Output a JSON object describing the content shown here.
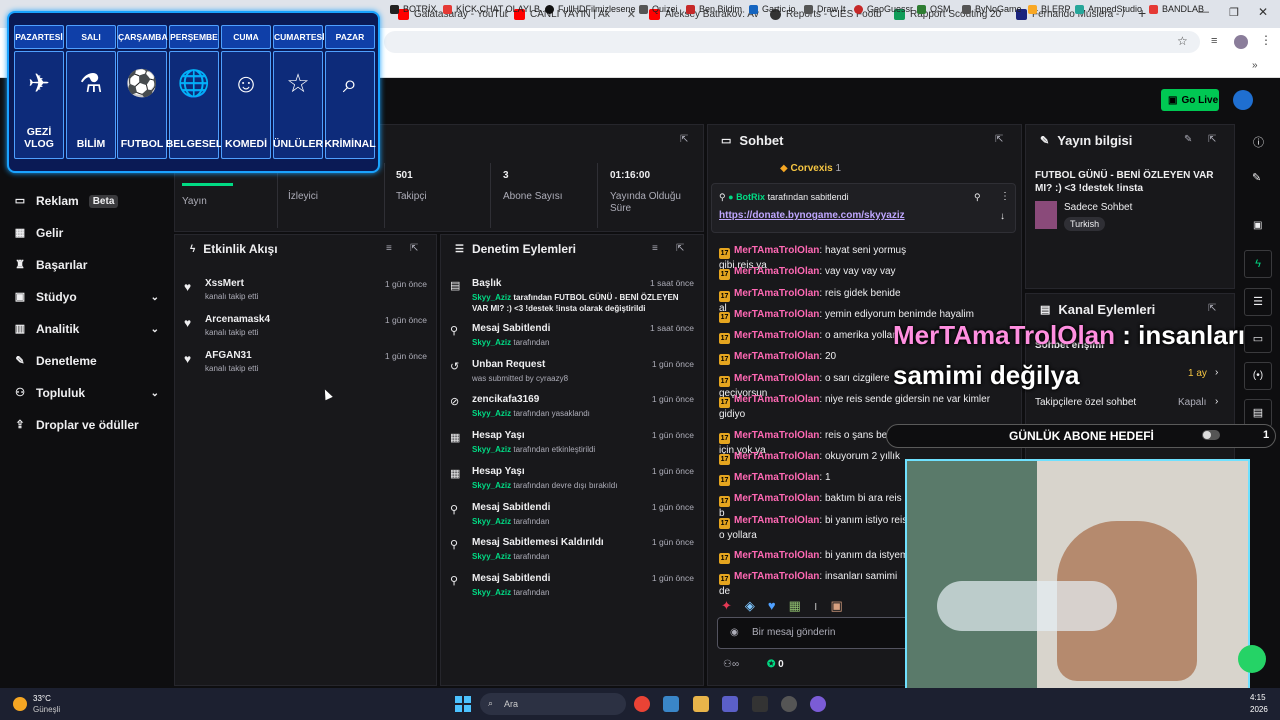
{
  "browser": {
    "tabs": [
      {
        "title": "Galatasaray - YouTube",
        "color": "#ff0000"
      },
      {
        "title": "CANLI YAYIN | Ak",
        "color": "#ff0000"
      },
      {
        "title": "Aleksey Batrakov: Av",
        "color": "#ff0000"
      },
      {
        "title": "Reports - CIES Footb",
        "color": "#333333"
      },
      {
        "title": "Rapport Scouting 20",
        "color": "#0f9d58"
      },
      {
        "title": "Fernando Muslera - /",
        "color": "#1a237e"
      }
    ],
    "new_tab": "+",
    "bookmarks": [
      "BOTRİX",
      "KİCK CHAT OLAYI B...",
      "FullHDFilmizlesene",
      "Quizei",
      "Ben Bildim",
      "Gartic.io",
      "Draw It",
      "GeoGuessr",
      "OSM",
      "ByNoGame",
      "BLERP",
      "AmpedStudio",
      "BANDLAB"
    ]
  },
  "header": {
    "go_live": "Go Live"
  },
  "schedule": {
    "days": [
      {
        "day": "PAZARTESİ",
        "category": "GEZİ VLOG",
        "icon": "globe-plane-icon",
        "glyph": "✈"
      },
      {
        "day": "SALI",
        "category": "BİLİM",
        "icon": "science-icon",
        "glyph": "⚗"
      },
      {
        "day": "ÇARŞAMBA",
        "category": "FUTBOL",
        "icon": "football-icon",
        "glyph": "⚽"
      },
      {
        "day": "PERŞEMBE",
        "category": "BELGESEL",
        "icon": "globe-icon",
        "glyph": "🌐"
      },
      {
        "day": "CUMA",
        "category": "KOMEDİ",
        "icon": "theater-mask-icon",
        "glyph": "☺"
      },
      {
        "day": "CUMARTESİ",
        "category": "ÜNLÜLER",
        "icon": "star-icon",
        "glyph": "☆"
      },
      {
        "day": "PAZAR",
        "category": "KRİMİNAL",
        "icon": "fingerprint-magnifier-icon",
        "glyph": "⌕"
      }
    ]
  },
  "sidebar": {
    "items": [
      {
        "label": "Reklam",
        "badge": "Beta",
        "icon": "ad-icon",
        "glyph": "▭"
      },
      {
        "label": "Gelir",
        "icon": "revenue-icon",
        "glyph": "▦"
      },
      {
        "label": "Başarılar",
        "icon": "trophy-icon",
        "glyph": "♜"
      },
      {
        "label": "Stüdyo",
        "icon": "studio-icon",
        "glyph": "▣",
        "chevron": "⌄"
      },
      {
        "label": "Analitik",
        "icon": "analytics-icon",
        "glyph": "▥",
        "chevron": "⌄"
      },
      {
        "label": "Denetleme",
        "icon": "wrench-icon",
        "glyph": "✎"
      },
      {
        "label": "Topluluk",
        "icon": "community-icon",
        "glyph": "⚇",
        "chevron": "⌄"
      },
      {
        "label": "Droplar ve ödüller",
        "icon": "drops-icon",
        "glyph": "⇪"
      }
    ]
  },
  "stats": {
    "items": [
      {
        "value": "",
        "label": "Yayın"
      },
      {
        "value": "",
        "label": "İzleyici"
      },
      {
        "value": "501",
        "label": "Takipçi"
      },
      {
        "value": "3",
        "label": "Abone Sayısı"
      },
      {
        "value": "01:16:00",
        "label": "Yayında Olduğu Süre"
      }
    ]
  },
  "activity": {
    "title": "Etkinlik Akışı",
    "items": [
      {
        "user": "XssMert",
        "action": "kanalı takip etti",
        "time": "1 gün önce"
      },
      {
        "user": "Arcenamask4",
        "action": "kanalı takip etti",
        "time": "1 gün önce"
      },
      {
        "user": "AFGAN31",
        "action": "kanalı takip etti",
        "time": "1 gün önce"
      }
    ]
  },
  "moderation": {
    "title": "Denetim Eylemleri",
    "items": [
      {
        "title": "Başlık",
        "user": "Skyy_Aziz",
        "detail": "tarafından FUTBOL GÜNÜ - BENİ ÖZLEYEN VAR MI? :) <3 !destek !insta olarak değiştirildi",
        "time": "1 saat önce",
        "icon": "title-icon",
        "glyph": "▤"
      },
      {
        "title": "Mesaj Sabitlendi",
        "user": "Skyy_Aziz",
        "detail": "tarafından",
        "time": "1 saat önce",
        "icon": "pin-icon",
        "glyph": "⚲"
      },
      {
        "title": "Unban Request",
        "user": "",
        "detail": "was submitted by cyraazy8",
        "time": "1 gün önce",
        "icon": "unban-icon",
        "glyph": "↺"
      },
      {
        "title": "zencikafa3169",
        "user": "Skyy_Aziz",
        "detail": "tarafından yasaklandı",
        "time": "1 gün önce",
        "icon": "ban-icon",
        "glyph": "⊘"
      },
      {
        "title": "Hesap Yaşı",
        "user": "Skyy_Aziz",
        "detail": "tarafından etkinleştirildi",
        "time": "1 gün önce",
        "icon": "calendar-icon",
        "glyph": "▦"
      },
      {
        "title": "Hesap Yaşı",
        "user": "Skyy_Aziz",
        "detail": "tarafından devre dışı bırakıldı",
        "time": "1 gün önce",
        "icon": "calendar-icon",
        "glyph": "▦"
      },
      {
        "title": "Mesaj Sabitlendi",
        "user": "Skyy_Aziz",
        "detail": "tarafından",
        "time": "1 gün önce",
        "icon": "pin-icon",
        "glyph": "⚲"
      },
      {
        "title": "Mesaj Sabitlemesi Kaldırıldı",
        "user": "Skyy_Aziz",
        "detail": "tarafından",
        "time": "1 gün önce",
        "icon": "unpin-icon",
        "glyph": "⚲"
      },
      {
        "title": "Mesaj Sabitlendi",
        "user": "Skyy_Aziz",
        "detail": "tarafından",
        "time": "1 gün önce",
        "icon": "pin-icon",
        "glyph": "⚲"
      }
    ]
  },
  "chat": {
    "title": "Sohbet",
    "top_user": "Corvexis",
    "top_count": "1",
    "pinned_by": "BotRix",
    "pinned_suffix": "tarafından sabitlendi",
    "pinned_link": "https://donate.bynogame.com/skyyaziz",
    "user": "MerTAmaTrolOlan",
    "messages": [
      "hayat seni yormuş gibi reis ya",
      "vay vay vay vay",
      "reis gidek benide al",
      "yemin ediyorum benimde hayalim",
      "o amerika yolları",
      "20",
      "o sarı cizgilere geçiyorsun",
      "niye reis sende gidersin ne var kimler gidiyo",
      "reis o şans benim için yok ya",
      "okuyorum 2 yıllık",
      "1",
      "baktım bi ara reis b",
      "bi yanım istiyo reis o yollara",
      "bi yanım da istyem",
      "insanları samimi de"
    ],
    "input_placeholder": "Bir mesaj gönderin",
    "points": "0"
  },
  "stream_info": {
    "title": "Yayın bilgisi",
    "stream_title": "FUTBOL GÜNÜ - BENİ ÖZLEYEN VAR MI? :) <3 !destek !insta",
    "category": "Sadece Sohbet",
    "tag": "Turkish"
  },
  "channel_actions": {
    "title": "Kanal Eylemleri",
    "items": [
      {
        "label": "Sohbet erişimi",
        "value": ""
      },
      {
        "label": "",
        "value": "1 ay"
      },
      {
        "label": "Takipçilere özel sohbet",
        "value": "Kapalı"
      }
    ]
  },
  "overlay": {
    "chat_user": "MerTAmaTrolOlan",
    "chat_text": ": insanları samimi değilya",
    "sub_goal": "GÜNLÜK ABONE HEDEFİ",
    "sub_goal_progress": 0,
    "sub_goal_count": "1"
  },
  "taskbar": {
    "weather_temp": "33°C",
    "weather_desc": "Güneşli",
    "search": "Ara",
    "time": "4:15",
    "date": "2026"
  }
}
